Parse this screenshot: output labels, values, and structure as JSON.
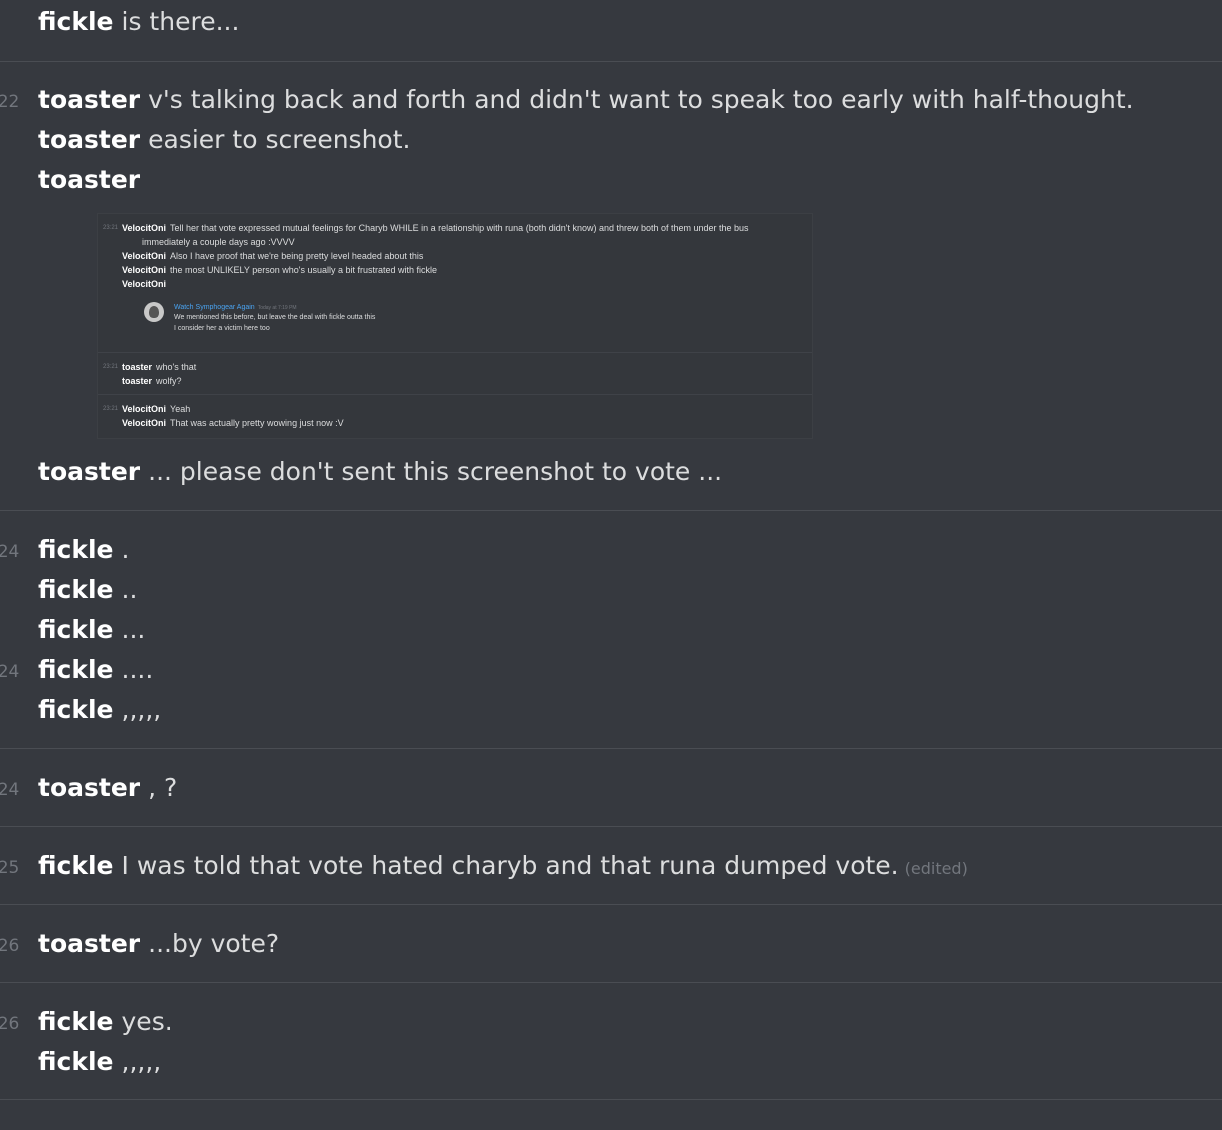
{
  "messages": [
    {
      "time": "",
      "author": "fickle",
      "text": "is there..."
    },
    {
      "time": ":22",
      "author": "toaster",
      "text": "v's talking back and forth and didn't want to speak too early with half-thought."
    },
    {
      "time": "",
      "author": "toaster",
      "text": "easier to screenshot."
    },
    {
      "time": "",
      "author": "toaster",
      "text": ""
    },
    {
      "time": "",
      "author": "toaster",
      "text": "... please don't sent this screenshot to vote ..."
    },
    {
      "time": ":24",
      "author": "fickle",
      "text": "."
    },
    {
      "time": "",
      "author": "fickle",
      "text": ".."
    },
    {
      "time": "",
      "author": "fickle",
      "text": "..."
    },
    {
      "time": ":24",
      "author": "fickle",
      "text": "...."
    },
    {
      "time": "",
      "author": "fickle",
      "text": ",,,,,"
    },
    {
      "time": ":24",
      "author": "toaster",
      "text": ", ?"
    },
    {
      "time": ":25",
      "author": "fickle",
      "text": "I was told that vote hated charyb and that runa dumped vote.",
      "edited": "(edited)"
    },
    {
      "time": ":26",
      "author": "toaster",
      "text": "...by vote?"
    },
    {
      "time": ":26",
      "author": "fickle",
      "text": "yes."
    },
    {
      "time": "",
      "author": "fickle",
      "text": ",,,,,"
    }
  ],
  "embed": {
    "lines": [
      {
        "time": "23:21",
        "author": "VelocitOni",
        "text": "Tell her that vote expressed mutual feelings for Charyb WHILE in a relationship with runa (both didn't know) and threw both of them under the bus"
      },
      {
        "time": "",
        "author": "",
        "text": "immediately a couple days ago :VVVV"
      },
      {
        "time": "",
        "author": "VelocitOni",
        "text": "Also I have proof that we're being pretty level headed about this"
      },
      {
        "time": "",
        "author": "VelocitOni",
        "text": "the most UNLIKELY person who's usually a bit frustrated with fickle"
      },
      {
        "time": "",
        "author": "VelocitOni",
        "text": ""
      },
      {
        "time": "23:21",
        "author": "toaster",
        "text": "who's that"
      },
      {
        "time": "",
        "author": "toaster",
        "text": "wolfy?"
      },
      {
        "time": "23:21",
        "author": "VelocitOni",
        "text": "Yeah"
      },
      {
        "time": "",
        "author": "VelocitOni",
        "text": "That was actually pretty wowing just now :V"
      }
    ],
    "quote": {
      "name": "Watch Symphogear Again",
      "time": "Today at 7:19 PM",
      "line1": "We mentioned this before, but leave the deal with fickle outta this",
      "line2": "I consider her a victim here too"
    }
  }
}
